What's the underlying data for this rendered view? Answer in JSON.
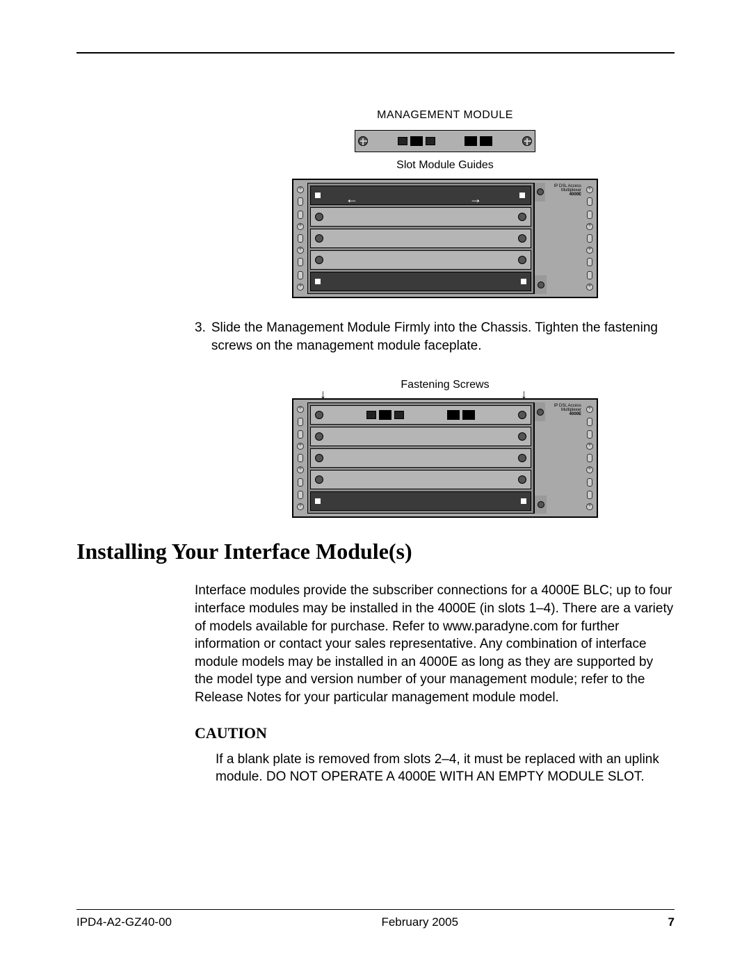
{
  "figure1": {
    "title": "MANAGEMENT MODULE",
    "subcaption": "Slot Module Guides"
  },
  "step3": {
    "number": "3.",
    "text": "Slide the Management Module Firmly into the Chassis. Tighten the fastening screws on the management module faceplate."
  },
  "figure2": {
    "title": "Fastening Screws"
  },
  "chassis_label": {
    "line1": "IP DSL Access Multiplexer",
    "line2": "4000E"
  },
  "section": {
    "heading": "Installing Your Interface Module(s)",
    "paragraph": "Interface modules provide the subscriber connections for a 4000E BLC; up to four interface modules may be installed in the 4000E (in slots 1–4). There are a variety of models available for purchase. Refer to www.paradyne.com for further information or contact your sales representative. Any combination of interface module models may be installed in an 4000E as long as they are supported by the model type and version number of your management module; refer to the Release Notes for your particular management module model."
  },
  "caution": {
    "heading": "CAUTION",
    "text": "If a blank plate is removed from slots 2–4, it must be replaced with an uplink module. DO NOT OPERATE A 4000E WITH AN EMPTY MODULE SLOT."
  },
  "footer": {
    "left": "IPD4-A2-GZ40-00",
    "center": "February 2005",
    "right": "7"
  }
}
